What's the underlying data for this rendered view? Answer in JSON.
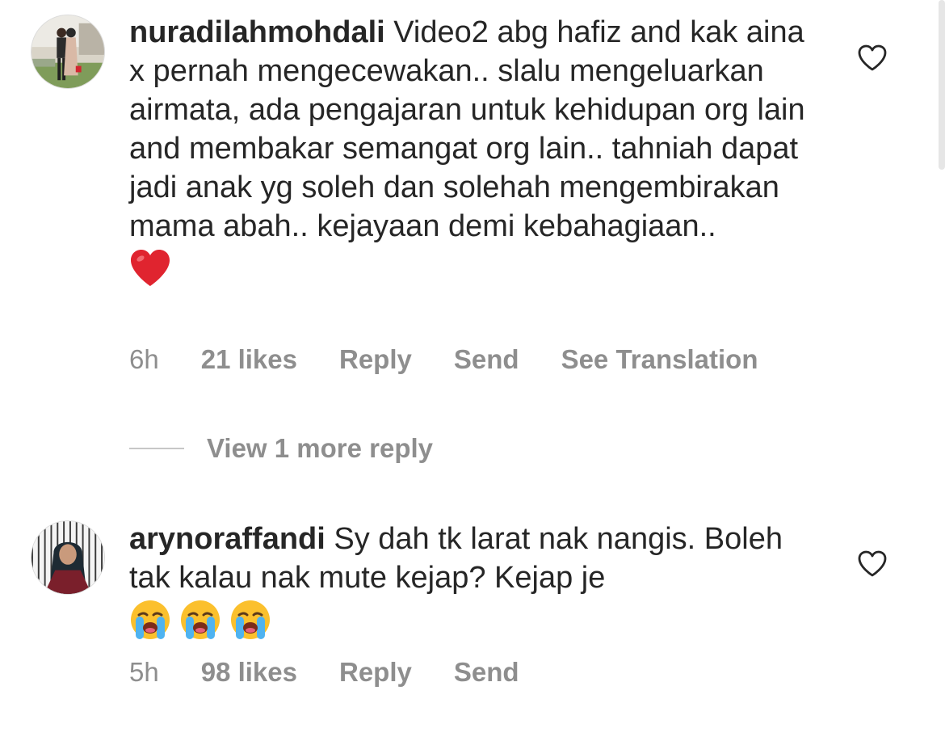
{
  "comments": [
    {
      "username": "nuradilahmohdali",
      "text": "Video2 abg hafiz and kak aina x pernah mengecewakan.. slalu mengeluarkan airmata, ada pengajaran untuk kehidupan org lain and membakar semangat org lain.. tahniah dapat jadi anak yg soleh dan solehah mengembirakan mama abah.. kejayaan demi kebahagiaan..",
      "emoji": "red-heart",
      "time": "6h",
      "likes": "21 likes",
      "reply_label": "Reply",
      "send_label": "Send",
      "translate_label": "See Translation"
    },
    {
      "username": "arynoraffandi",
      "text": "Sy dah tk larat nak nangis. Boleh tak kalau nak mute kejap? Kejap je",
      "emoji": "loudly-crying-face x3",
      "time": "5h",
      "likes": "98 likes",
      "reply_label": "Reply",
      "send_label": "Send"
    }
  ],
  "view_replies": {
    "label": "View 1 more reply"
  },
  "colors": {
    "text": "#262626",
    "secondary": "#8e8e8e",
    "heart_emoji": "#e0242f",
    "divider": "#c7c7c7"
  }
}
